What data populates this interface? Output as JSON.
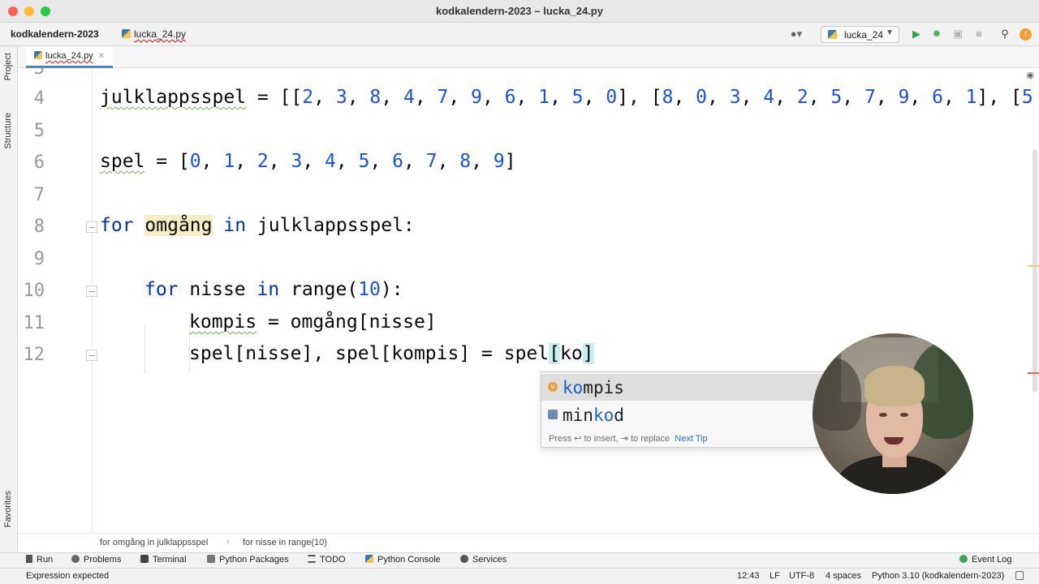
{
  "window": {
    "title": "kodkalendern-2023 – lucka_24.py"
  },
  "navbar": {
    "project": "kodkalendern-2023",
    "file": "lucka_24.py",
    "run_config": "lucka_24",
    "icons": [
      "user-icon",
      "run-icon",
      "debug-icon",
      "coverage-icon",
      "stop-icon",
      "search-icon",
      "update-icon"
    ]
  },
  "side_tools": {
    "project": "Project",
    "structure": "Structure",
    "favorites": "Favorites"
  },
  "tabs": [
    {
      "label": "lucka_24.py",
      "active": true
    }
  ],
  "editor": {
    "lines": [
      {
        "number": "3",
        "text": ""
      },
      {
        "number": "4",
        "text": "julklappsspel = [[2, 3, 8, 4, 7, 9, 6, 1, 5, 0], [8, 0, 3, 4, 2, 5, 7, 9, 6, 1], [5"
      },
      {
        "number": "5",
        "text": ""
      },
      {
        "number": "6",
        "text": "spel = [0, 1, 2, 3, 4, 5, 6, 7, 8, 9]"
      },
      {
        "number": "7",
        "text": ""
      },
      {
        "number": "8",
        "text": "for omgång in julklappsspel:"
      },
      {
        "number": "9",
        "text": ""
      },
      {
        "number": "10",
        "text": "for nisse in range(10):"
      },
      {
        "number": "11",
        "text": "kompis = omgång[nisse]"
      },
      {
        "number": "12",
        "text": "spel[nisse], spel[kompis] = spel[ko]"
      }
    ],
    "tokens": {
      "l4_var": "julklappsspel",
      "l4_rest_a": " = [[",
      "l6_var": "spel",
      "l6_rest": " = [",
      "l8_for": "for",
      "l8_var": "omgång",
      "l8_in": "in",
      "l8_rest": "julklappsspel:",
      "l10_for": "for",
      "l10_var": "nisse",
      "l10_in": "in",
      "l10_fn": "range(",
      "l10_num": "10",
      "l10_end": "):",
      "l11_var": "kompis",
      "l11_rest": " = omgång[nisse]",
      "l12_a": "spel[nisse], spel[kompis] = spel",
      "l12_lb": "[",
      "l12_typed": "ko",
      "l12_rb": "]"
    }
  },
  "completion": {
    "items": [
      {
        "match": "ko",
        "rest": "mpis",
        "kind": "v",
        "label": "kompis",
        "selected": true
      },
      {
        "prefix": "min",
        "match": "ko",
        "rest": "d",
        "kind": "module",
        "label": "minkod",
        "selected": false
      }
    ],
    "footer": "Press ↩ to insert, ⇥ to replace",
    "tip": "Next Tip"
  },
  "breadcrumbs": [
    "for omgång in julklappsspel",
    "for nisse in range(10)"
  ],
  "tool_windows": [
    "Run",
    "Problems",
    "Terminal",
    "Python Packages",
    "TODO",
    "Python Console",
    "Services",
    "Event Log"
  ],
  "status": {
    "message": "Expression expected",
    "position": "12:43",
    "line_sep": "LF",
    "encoding": "UTF-8",
    "indent": "4 spaces",
    "interpreter": "Python 3.10 (kodkalendern-2023)"
  },
  "colors": {
    "keyword": "#0033b3",
    "number": "#1750eb",
    "accent": "#4a88c7",
    "selection_highlight": "#f6ecc5"
  }
}
